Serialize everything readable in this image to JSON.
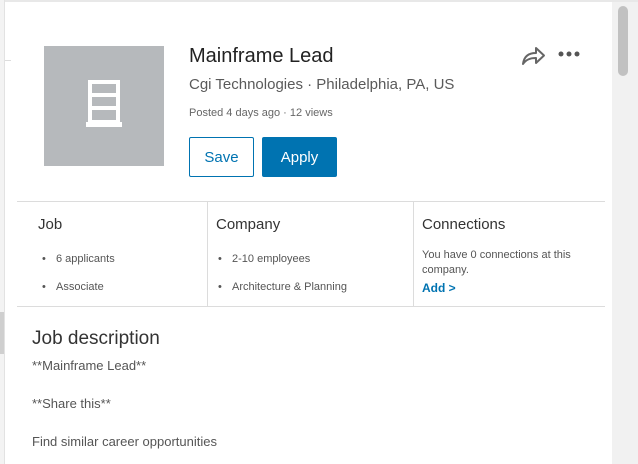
{
  "job": {
    "title": "Mainframe Lead",
    "company_location": "Cgi Technologies · Philadelphia, PA, US",
    "meta": "Posted 4 days ago · 12 views"
  },
  "actions": {
    "save_label": "Save",
    "apply_label": "Apply",
    "share_icon": "share-icon",
    "more_icon": "more-options-icon"
  },
  "info": {
    "job": {
      "heading": "Job",
      "items": [
        "6 applicants",
        "Associate"
      ]
    },
    "company": {
      "heading": "Company",
      "items": [
        "2-10 employees",
        "Architecture & Planning"
      ]
    },
    "connections": {
      "heading": "Connections",
      "text": "You have 0 connections at this company.",
      "add_label": "Add >"
    }
  },
  "description": {
    "heading": "Job description",
    "lines": [
      "**Mainframe Lead**",
      "**Share this**",
      "Find similar career opportunities"
    ]
  },
  "colors": {
    "accent": "#0073b1",
    "logo_bg": "#b6b9bc"
  }
}
